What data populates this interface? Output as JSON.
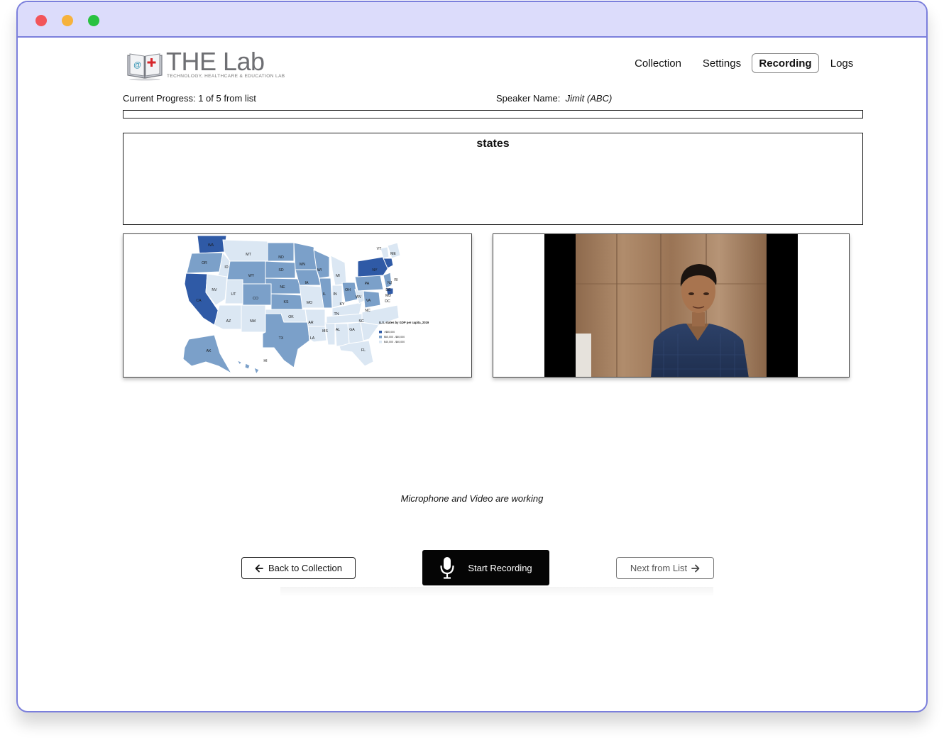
{
  "app": {
    "logo_title": "THE Lab",
    "logo_subtitle": "TECHNOLOGY, HEALTHCARE & EDUCATION LAB"
  },
  "nav": {
    "items": [
      {
        "label": "Collection",
        "active": false
      },
      {
        "label": "Settings",
        "active": false
      },
      {
        "label": "Recording",
        "active": true
      },
      {
        "label": "Logs",
        "active": false
      }
    ]
  },
  "session": {
    "progress_text": "Current Progress: 1 of 5 from list",
    "progress_fraction": 0.0,
    "speaker_label": "Speaker Name:",
    "speaker_name": "Jimit (ABC)"
  },
  "prompt": {
    "word": "states"
  },
  "map_legend": {
    "title": "U.S. states by GDP per capita, 2019",
    "items": [
      ">$80,000",
      "$60,000 - $80,000",
      "$40,000 - $60,000"
    ]
  },
  "map_states": [
    "WA",
    "OR",
    "CA",
    "MT",
    "ID",
    "NV",
    "UT",
    "AZ",
    "WY",
    "CO",
    "NM",
    "ND",
    "SD",
    "NE",
    "KS",
    "OK",
    "TX",
    "MN",
    "IA",
    "MO",
    "AR",
    "LA",
    "WI",
    "IL",
    "MS",
    "MI",
    "IN",
    "KY",
    "TN",
    "AL",
    "OH",
    "WV",
    "VA",
    "NC",
    "SC",
    "GA",
    "FL",
    "PA",
    "NY",
    "ME",
    "VT",
    "NJ",
    "DE",
    "MD",
    "DC",
    "RI",
    "AK",
    "HI"
  ],
  "status": {
    "message": "Microphone and Video are working"
  },
  "buttons": {
    "back": "Back to Collection",
    "record": "Start Recording",
    "next": "Next from List"
  },
  "colors": {
    "accent": "#7b7fdc",
    "map_dark": "#2f5aa6",
    "map_mid": "#7ba0c9",
    "map_light": "#dbe7f3"
  }
}
